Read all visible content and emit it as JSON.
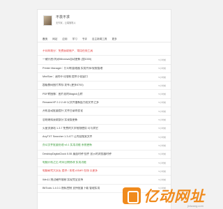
{
  "profile": {
    "name": "不羡不求",
    "bio": "无作家，云端随笔以"
  },
  "tabs": [
    "首页",
    "网站",
    "应用",
    "学习",
    "书评",
    "自主新闻工具",
    "更多"
  ],
  "rows": [
    {
      "title": "不同年前分：免费获取账户、常用在线工具",
      "meta": "",
      "style": "red"
    },
    {
      "title": "一键开启/关闭Windows自动更新 (加1000)",
      "meta": "5小时前",
      "style": "normal"
    },
    {
      "title": "Printer Manager：打印机管理器 实用共享/权限管理",
      "meta": "5小时前",
      "style": "normal"
    },
    {
      "title": "MiniSize：迷你不可限制 提供小化窗口",
      "meta": "5小时前",
      "style": "normal"
    },
    {
      "title": "超级数码图片库存 发布 (更多5700)",
      "meta": "5小时前",
      "style": "normal"
    },
    {
      "title": "PDF转图像：图片化的Magick互转",
      "meta": "5小时前",
      "style": "normal"
    },
    {
      "title": "RenameXP 2.2.2.40 以文件重新起为用文件之多",
      "meta": "5小时前",
      "style": "normal"
    },
    {
      "title": "开机自动批量提升 文件目录的优化",
      "meta": "5小时前",
      "style": "normal"
    },
    {
      "title": "总结继续获取部分 实现版更新",
      "meta": "5小时前",
      "style": "normal"
    },
    {
      "title": "火星资源站 1.3.7 免费的大学视频使用 可与其它",
      "meta": "5小时前",
      "style": "normal"
    },
    {
      "title": "AnyTXT Searcher 1.3.477 让内容搜索文件",
      "meta": "5小时前",
      "style": "normal"
    },
    {
      "title": "办公文件批量处理 v6.1 实用功能 系统更新",
      "meta": "5小时前",
      "style": "green"
    },
    {
      "title": "DesktopDigitalClock 5.55 桌面时钟 挂件 显示的浏览器时钟",
      "meta": "5小时前",
      "style": "normal"
    },
    {
      "title": "电脑开机之后 时间日期修改 实用功能",
      "meta": "5小时前",
      "style": "green"
    },
    {
      "title": "电脑研究大队伍 提供 / 本地 ASMR 在线 以更多",
      "meta": "5小时前",
      "style": "red"
    },
    {
      "title": "Win11 绕过硬件限制 实现完全支持",
      "meta": "5小时前",
      "style": "normal"
    },
    {
      "title": "BitTools 1.4.0.1 隐私控制 支持批量下载 管理实用",
      "meta": "5小时前",
      "style": "normal"
    }
  ],
  "watermark": {
    "text": "亿动网址",
    "sub": "jixiwang.com"
  },
  "colors": {
    "red": "#e23b3b",
    "green": "#3a9b3a",
    "orange": "#f08a1c"
  }
}
